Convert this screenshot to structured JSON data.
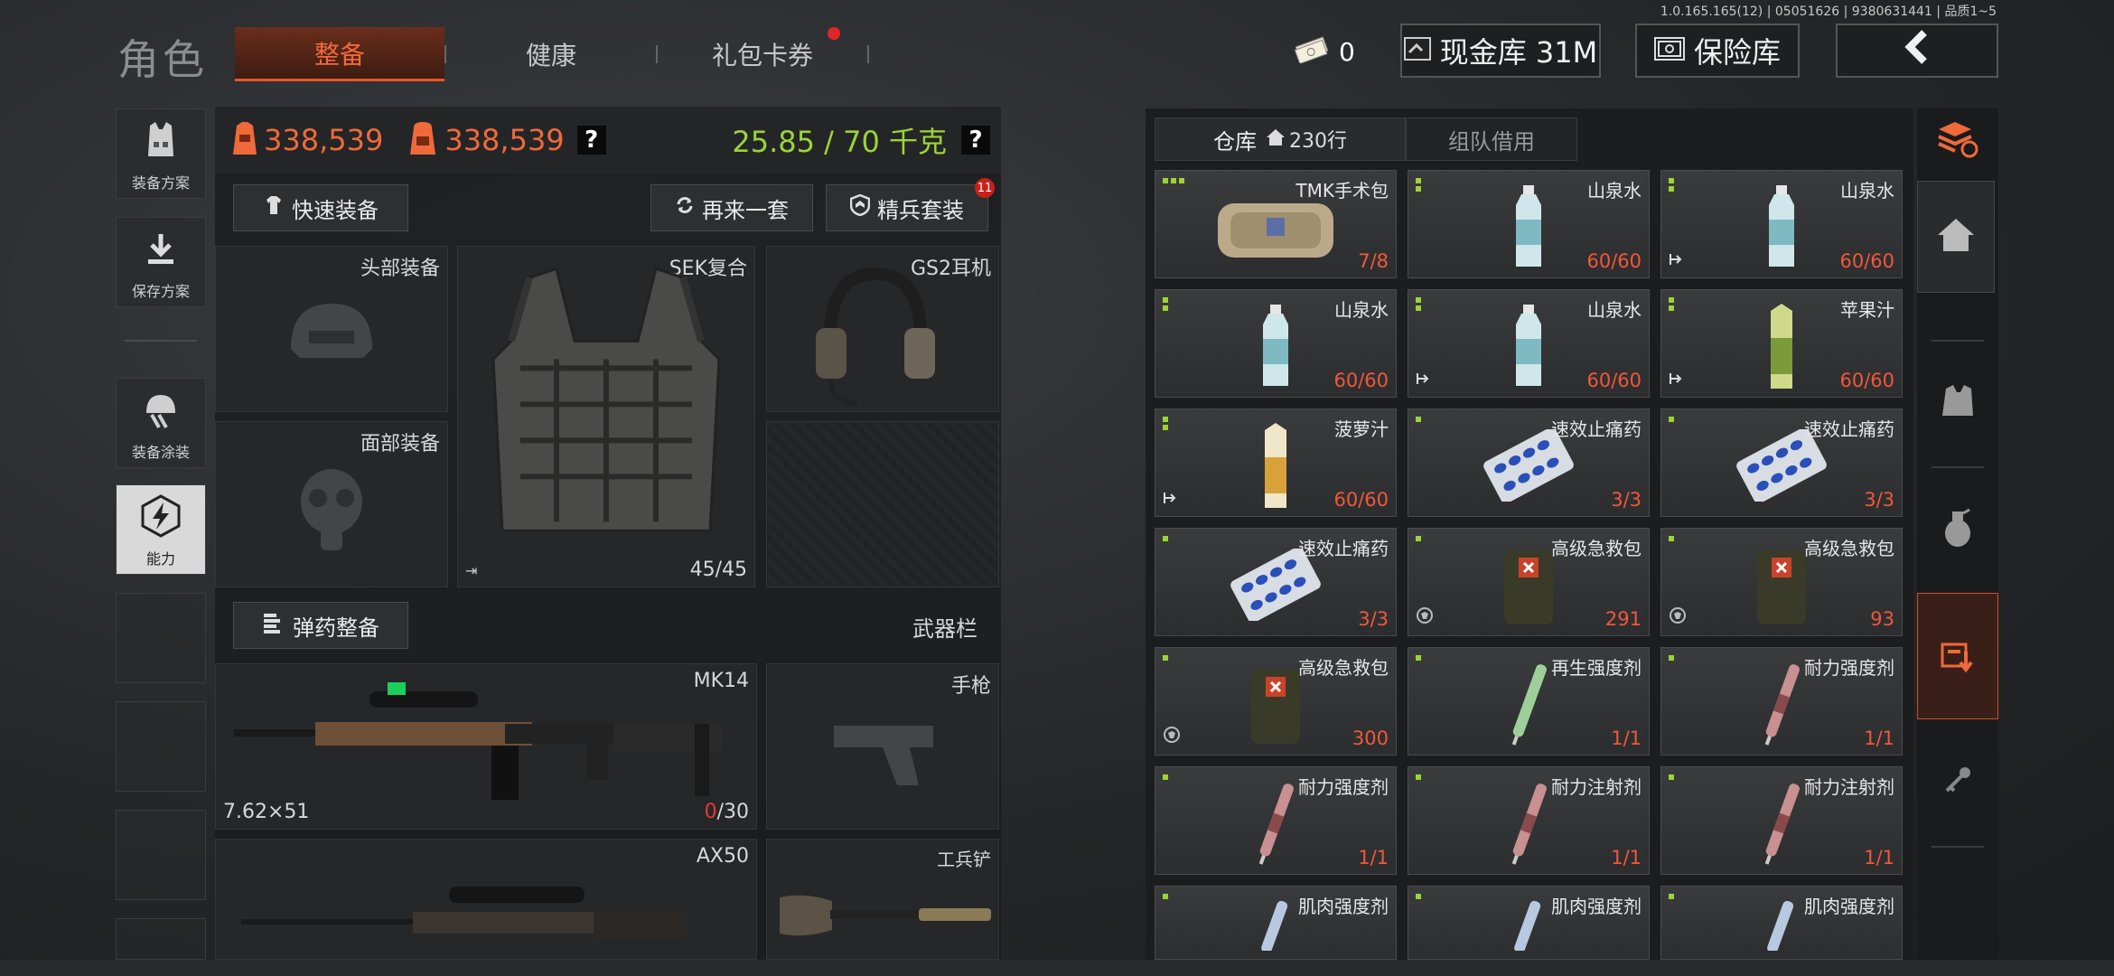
{
  "version": "1.0.165.165(12) | 05051626 | 9380631441 | 品质1~5",
  "header": {
    "title": "角色",
    "tabs": [
      {
        "label": "整备",
        "active": true
      },
      {
        "label": "健康",
        "active": false
      },
      {
        "label": "礼包卡券",
        "active": false,
        "has_dot": true
      }
    ],
    "cash": "0",
    "cash_library": "现金库 31M",
    "safe_library": "保险库",
    "back_icon": "chevron-left-icon"
  },
  "left_sidebar": [
    {
      "label": "装备方案",
      "icon": "vest-icon"
    },
    {
      "label": "保存方案",
      "icon": "download-icon"
    },
    {
      "label": "装备涂装",
      "icon": "helmet-paint-icon"
    },
    {
      "label": "能力",
      "icon": "ability-icon",
      "active": true
    }
  ],
  "loadout": {
    "value_1": "338,539",
    "value_2": "338,539",
    "weight": "25.85 / 70 千克",
    "help": "?",
    "quick_equip": "快速装备",
    "again": "再来一套",
    "elite_kit": "精兵套装",
    "elite_badge": "11",
    "slots": {
      "head": "头部装备",
      "face": "面部装备",
      "armor_name": "SEK复合",
      "armor_durability": "45/45",
      "headset": "GS2耳机"
    },
    "ammo_btn": "弹药整备",
    "weapon_bar": "武器栏",
    "primary": {
      "name": "MK14",
      "caliber": "7.62×51",
      "ammo_current": "0",
      "ammo_max": "/30"
    },
    "pistol": "手枪",
    "secondary": {
      "name": "AX50"
    },
    "melee": "工兵铲"
  },
  "inventory": {
    "tab_warehouse": "仓库",
    "rows": "230行",
    "tab_team": "组队借用",
    "items": [
      {
        "name": "TMK手术包",
        "qty": "7/8",
        "art": "bag"
      },
      {
        "name": "山泉水",
        "qty": "60/60",
        "art": "bottle"
      },
      {
        "name": "山泉水",
        "qty": "60/60",
        "art": "bottle",
        "flag": "exit"
      },
      {
        "name": "山泉水",
        "qty": "60/60",
        "art": "bottle"
      },
      {
        "name": "山泉水",
        "qty": "60/60",
        "art": "bottle",
        "flag": "exit"
      },
      {
        "name": "苹果汁",
        "qty": "60/60",
        "art": "juice-green",
        "flag": "exit"
      },
      {
        "name": "菠萝汁",
        "qty": "60/60",
        "art": "juice-orange",
        "flag": "exit"
      },
      {
        "name": "速效止痛药",
        "qty": "3/3",
        "art": "pills"
      },
      {
        "name": "速效止痛药",
        "qty": "3/3",
        "art": "pills"
      },
      {
        "name": "速效止痛药",
        "qty": "3/3",
        "art": "pills"
      },
      {
        "name": "高级急救包",
        "qty": "291",
        "art": "medkit",
        "flag": "shield"
      },
      {
        "name": "高级急救包",
        "qty": "93",
        "art": "medkit",
        "flag": "shield"
      },
      {
        "name": "高级急救包",
        "qty": "300",
        "art": "medkit",
        "flag": "shield"
      },
      {
        "name": "再生强度剂",
        "qty": "1/1",
        "art": "syringe-green"
      },
      {
        "name": "耐力强度剂",
        "qty": "1/1",
        "art": "syringe-red"
      },
      {
        "name": "耐力强度剂",
        "qty": "1/1",
        "art": "syringe-red"
      },
      {
        "name": "耐力注射剂",
        "qty": "1/1",
        "art": "syringe-red"
      },
      {
        "name": "耐力注射剂",
        "qty": "1/1",
        "art": "syringe-red"
      },
      {
        "name": "肌肉强度剂",
        "qty": "",
        "art": "syringe-blue"
      },
      {
        "name": "肌肉强度剂",
        "qty": "",
        "art": "syringe-blue"
      },
      {
        "name": "肌肉强度剂",
        "qty": "",
        "art": "syringe-blue"
      }
    ]
  },
  "right_rail": [
    "stack-refresh-icon",
    "home-icon",
    "vest-icon",
    "grenade-icon",
    "inbox-download-icon",
    "key-icon"
  ],
  "colors": {
    "accent": "#ef6a3a",
    "weight_green": "#9cd435",
    "qty_red": "#f0583a"
  }
}
